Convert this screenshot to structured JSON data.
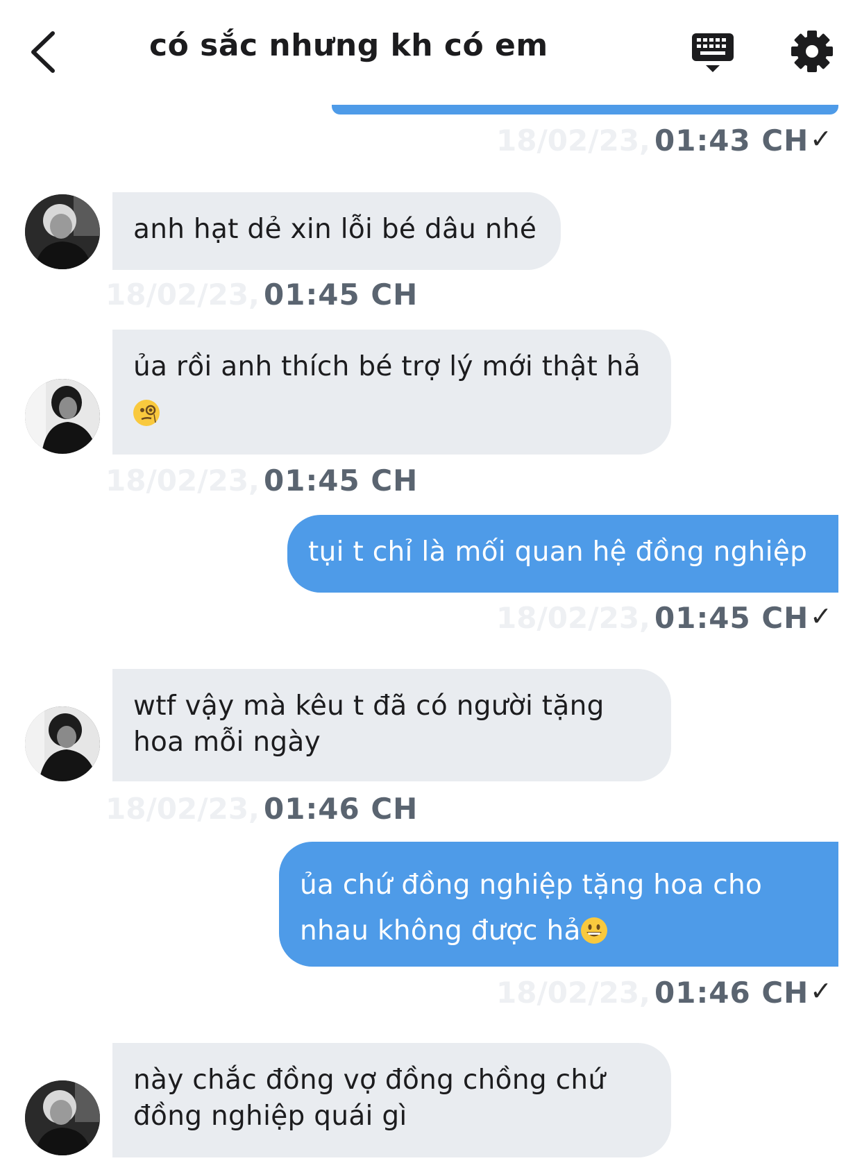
{
  "header": {
    "title": "có sắc nhưng kh có em"
  },
  "messages": [
    {
      "time": "01:43 CH",
      "date": "18/02/23,"
    },
    {
      "text_lines": [
        "anh hạt dẻ xin lỗi bé dâu nhé"
      ],
      "date": "18/02/23,",
      "time": "01:45 CH"
    },
    {
      "text_lines": [
        "ủa rồi anh thích bé trợ lý mới thật hả"
      ],
      "emoji": "face-with-monocle",
      "date": "18/02/23,",
      "time": "01:45 CH"
    },
    {
      "text_lines": [
        "tụi t chỉ là mối quan hệ đồng nghiệp"
      ],
      "date": "18/02/23,",
      "time": "01:45 CH"
    },
    {
      "text_lines": [
        "wtf vậy mà kêu t đã có người tặng",
        "hoa mỗi ngày"
      ],
      "date": "18/02/23,",
      "time": "01:46 CH"
    },
    {
      "text_lines": [
        "ủa chứ đồng nghiệp tặng hoa cho",
        "nhau không được hả"
      ],
      "emoji": "grinning-face",
      "date": "18/02/23,",
      "time": "01:46 CH"
    },
    {
      "text_lines": [
        "này chắc đồng vợ đồng chồng chứ",
        "đồng nghiệp quái gì"
      ]
    }
  ],
  "read_mark": "✓",
  "colors": {
    "incoming_bubble": "#e9ecf0",
    "outgoing_bubble": "#4e9be8",
    "time_text": "#5a6470"
  }
}
